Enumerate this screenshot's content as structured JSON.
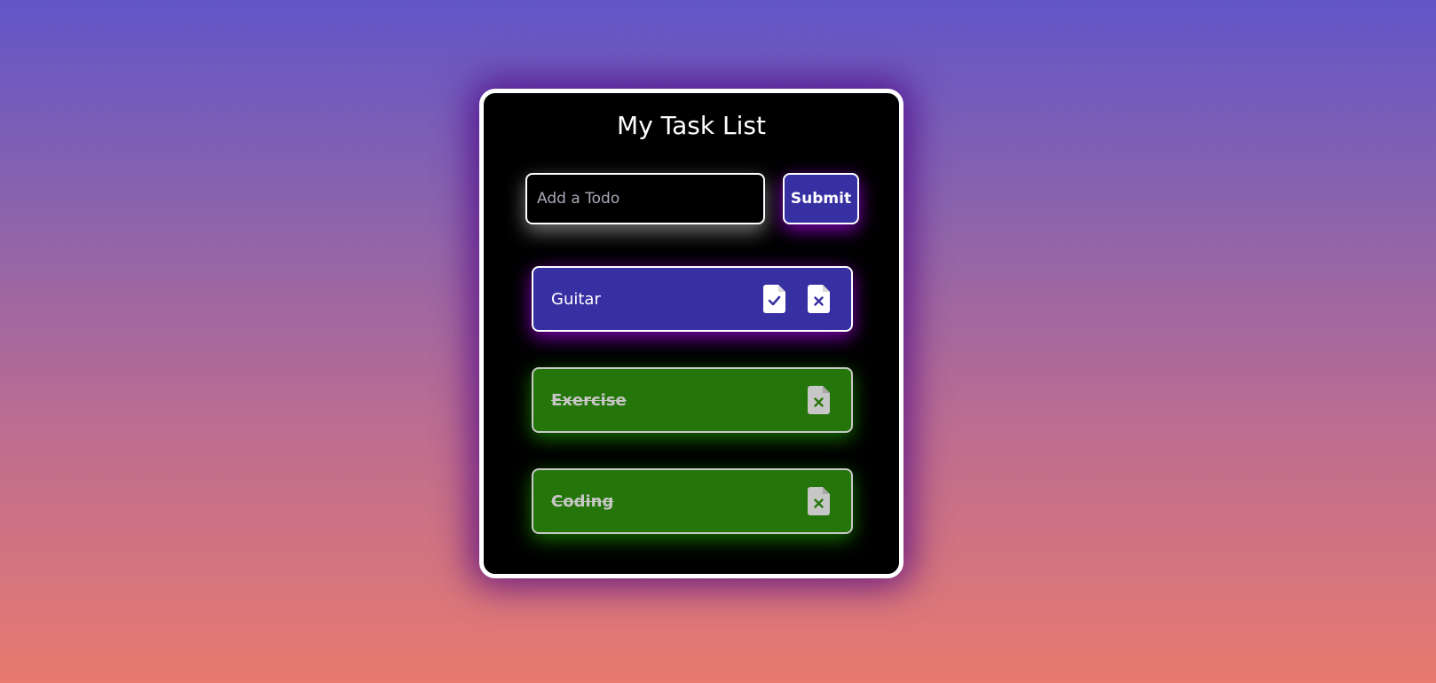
{
  "app": {
    "title": "My Task List"
  },
  "form": {
    "input_placeholder": "Add a Todo",
    "input_value": "",
    "submit_label": "Submit"
  },
  "tasks": [
    {
      "label": "Guitar",
      "completed": false,
      "actions": [
        "file-check-icon",
        "file-x-icon"
      ]
    },
    {
      "label": "Exercise",
      "completed": true,
      "actions": [
        "file-x-icon"
      ]
    },
    {
      "label": "Coding",
      "completed": true,
      "actions": [
        "file-x-icon"
      ]
    }
  ],
  "colors": {
    "pending_task": "#3730a3",
    "completed_task": "#25760a",
    "card_background": "#000000",
    "submit_button": "#3730a3"
  }
}
